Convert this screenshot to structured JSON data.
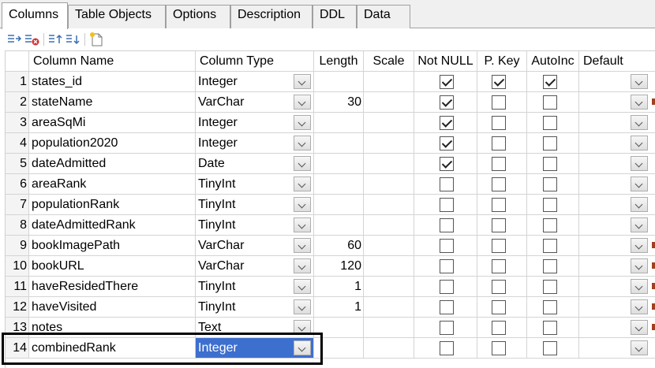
{
  "tabs": [
    {
      "label": "Columns",
      "active": true
    },
    {
      "label": "Table Objects",
      "active": false
    },
    {
      "label": "Options",
      "active": false
    },
    {
      "label": "Description",
      "active": false
    },
    {
      "label": "DDL",
      "active": false
    },
    {
      "label": "Data",
      "active": false
    }
  ],
  "toolbar": {
    "buttons": [
      {
        "icon": "insert-column-icon"
      },
      {
        "icon": "delete-column-icon"
      },
      {
        "icon": "move-up-icon"
      },
      {
        "icon": "move-down-icon"
      },
      {
        "icon": "new-document-icon"
      }
    ]
  },
  "grid": {
    "headers": {
      "name": "Column Name",
      "type": "Column Type",
      "length": "Length",
      "scale": "Scale",
      "not_null": "Not NULL",
      "pkey": "P. Key",
      "autoinc": "AutoInc",
      "default": "Default"
    },
    "rows": [
      {
        "num": "1",
        "name": "states_id",
        "type": "Integer",
        "length": "",
        "not_null": true,
        "pkey": true,
        "autoinc": true
      },
      {
        "num": "2",
        "name": "stateName",
        "type": "VarChar",
        "length": "30",
        "not_null": true,
        "pkey": false,
        "autoinc": false
      },
      {
        "num": "3",
        "name": "areaSqMi",
        "type": "Integer",
        "length": "",
        "not_null": true,
        "pkey": false,
        "autoinc": false
      },
      {
        "num": "4",
        "name": "population2020",
        "type": "Integer",
        "length": "",
        "not_null": true,
        "pkey": false,
        "autoinc": false
      },
      {
        "num": "5",
        "name": "dateAdmitted",
        "type": "Date",
        "length": "",
        "not_null": true,
        "pkey": false,
        "autoinc": false
      },
      {
        "num": "6",
        "name": "areaRank",
        "type": "TinyInt",
        "length": "",
        "not_null": false,
        "pkey": false,
        "autoinc": false
      },
      {
        "num": "7",
        "name": "populationRank",
        "type": "TinyInt",
        "length": "",
        "not_null": false,
        "pkey": false,
        "autoinc": false
      },
      {
        "num": "8",
        "name": "dateAdmittedRank",
        "type": "TinyInt",
        "length": "",
        "not_null": false,
        "pkey": false,
        "autoinc": false
      },
      {
        "num": "9",
        "name": "bookImagePath",
        "type": "VarChar",
        "length": "60",
        "not_null": false,
        "pkey": false,
        "autoinc": false
      },
      {
        "num": "10",
        "name": "bookURL",
        "type": "VarChar",
        "length": "120",
        "not_null": false,
        "pkey": false,
        "autoinc": false
      },
      {
        "num": "11",
        "name": "haveResidedThere",
        "type": "TinyInt",
        "length": "1",
        "not_null": false,
        "pkey": false,
        "autoinc": false
      },
      {
        "num": "12",
        "name": "haveVisited",
        "type": "TinyInt",
        "length": "1",
        "not_null": false,
        "pkey": false,
        "autoinc": false
      },
      {
        "num": "13",
        "name": "notes",
        "type": "Text",
        "length": "",
        "not_null": false,
        "pkey": false,
        "autoinc": false
      },
      {
        "num": "14",
        "name": "combinedRank",
        "type": "Integer",
        "length": "",
        "not_null": false,
        "pkey": false,
        "autoinc": false,
        "selected": true
      }
    ]
  },
  "colors": {
    "selection": "#3d6fce",
    "tab_border": "#a0a0a0",
    "grid_line": "#d4d4d4"
  }
}
